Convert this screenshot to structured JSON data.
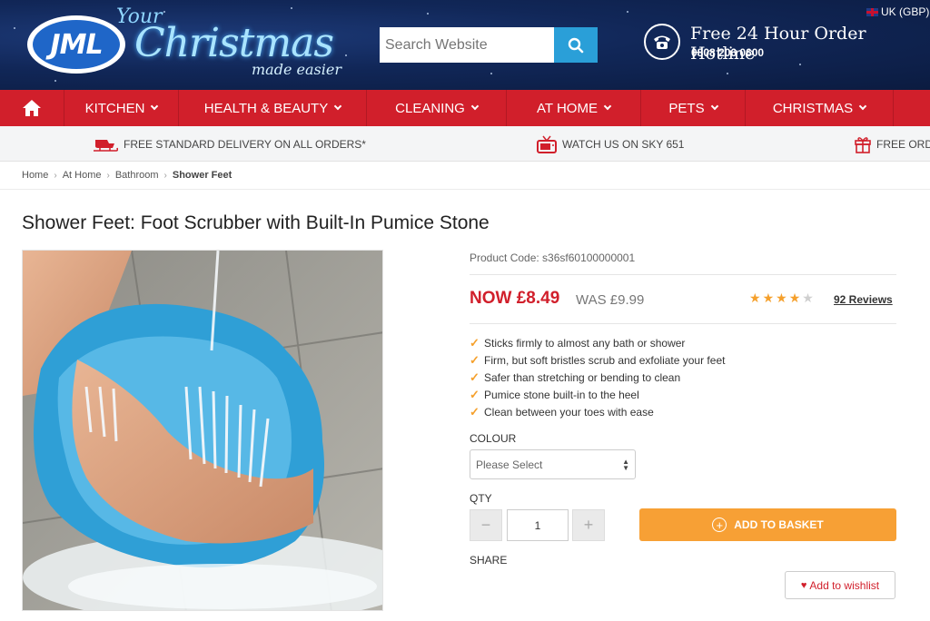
{
  "header": {
    "logo_text": "JML",
    "tagline_your": "Your",
    "tagline_christmas": "Christmas",
    "tagline_easier": "made easier",
    "search_placeholder": "Search Website",
    "hotline_title": "Free 24 Hour Order Hotline",
    "hotline_number": "0808 206 0600",
    "currency": "UK (GBP)"
  },
  "nav": {
    "items": [
      {
        "label": "KITCHEN"
      },
      {
        "label": "HEALTH & BEAUTY"
      },
      {
        "label": "CLEANING"
      },
      {
        "label": "AT HOME"
      },
      {
        "label": "PETS"
      },
      {
        "label": "CHRISTMAS"
      }
    ]
  },
  "promo": {
    "delivery": "FREE STANDARD DELIVERY ON ALL ORDERS*",
    "sky": "WATCH US ON SKY 651",
    "free": "FREE ORD"
  },
  "breadcrumb": [
    "Home",
    "At Home",
    "Bathroom",
    "Shower Feet"
  ],
  "product": {
    "title": "Shower Feet: Foot Scrubber with Built-In Pumice Stone",
    "code": "Product Code: s36sf60100000001",
    "price_now": "NOW £8.49",
    "price_was": "WAS £9.99",
    "rating": 4,
    "rating_max": 5,
    "reviews": "92 Reviews",
    "features": [
      "Sticks firmly to almost any bath or shower",
      "Firm, but soft bristles scrub and exfoliate your feet",
      "Safer than stretching or bending to clean",
      "Pumice stone built-in to the heel",
      "Clean between your toes with ease"
    ],
    "colour_label": "COLOUR",
    "colour_select": "Please Select",
    "qty_label": "QTY",
    "qty_value": "1",
    "qty_minus": "−",
    "qty_plus": "+",
    "add_to_basket": "ADD TO BASKET",
    "share_label": "SHARE",
    "wishlist": "Add to wishlist"
  },
  "colors": {
    "nav_red": "#d11f2b",
    "header_navy": "#112758",
    "search_blue": "#2a9fd8",
    "basket_orange": "#f7a035",
    "star_orange": "#f5a02c"
  },
  "icons": {
    "home": "home-icon",
    "search": "search-icon",
    "phone": "phone-icon",
    "sleigh": "sleigh-icon",
    "tv": "tv-icon",
    "gift": "gift-icon",
    "heart": "heart-icon",
    "tick": "tick-icon"
  }
}
